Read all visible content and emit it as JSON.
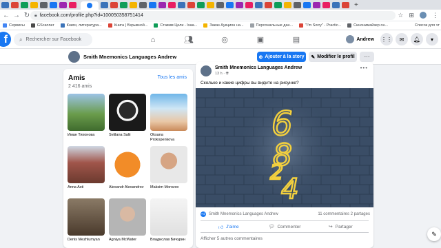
{
  "browser": {
    "url": "facebook.com/profile.php?id=100050358751414",
    "bookmarks": [
      {
        "label": "Сервисы",
        "color": "#4285f4"
      },
      {
        "label": "GScanner",
        "color": "#4a4a4a"
      },
      {
        "label": "Книги, литература...",
        "color": "#3b73b9"
      },
      {
        "label": "Книга | Взрывной...",
        "color": "#db4437"
      },
      {
        "label": "Ставим Цели - Isaa...",
        "color": "#0f9d58"
      },
      {
        "label": "Заказ Аукцион на...",
        "color": "#f4b400"
      },
      {
        "label": "Персональные дан...",
        "color": "#9aa0a6"
      },
      {
        "label": "\"I'm Sorry\" - Practic...",
        "color": "#db4437"
      },
      {
        "label": "Синонимайзер он...",
        "color": "#5f6368"
      }
    ],
    "bookmarks_right": "Список для чт"
  },
  "facebook": {
    "search_placeholder": "Rechercher sur Facebook",
    "user_short": "Andrew"
  },
  "profile": {
    "name": "Smith Mnemonics Languages Andrew",
    "add_story": "Ajouter à la story",
    "edit_profile": "Modifier le profil",
    "more": "···"
  },
  "friends": {
    "title": "Amis",
    "count": "2 416 amis",
    "see_all": "Tous les amis",
    "items": [
      {
        "name": "Иман Тихонова"
      },
      {
        "name": "Svitlana Salii"
      },
      {
        "name": "Oksana Prokopenkova"
      },
      {
        "name": "Anna Asti"
      },
      {
        "name": "Alexandr Alexandrov"
      },
      {
        "name": "Maksim Morozov"
      },
      {
        "name": "Denis Mezhlumyan"
      },
      {
        "name": "Agniya McWater"
      },
      {
        "name": "Владислав Бичурин"
      }
    ]
  },
  "post": {
    "author": "Smith Mnemonics Languages Andrew",
    "time": "13 h · ",
    "text": "Сколько и какие  цифры вы видите на рисунке?",
    "image_numbers": [
      "6",
      "8",
      "2",
      "4"
    ],
    "reactions_name": "Smith Mnemonics Languages Andrew",
    "stats": "11 commentaires  2 partages",
    "like": "J'aime",
    "comment": "Commenter",
    "share": "Partager",
    "more_comments": "Afficher 5 autres commentaires"
  }
}
